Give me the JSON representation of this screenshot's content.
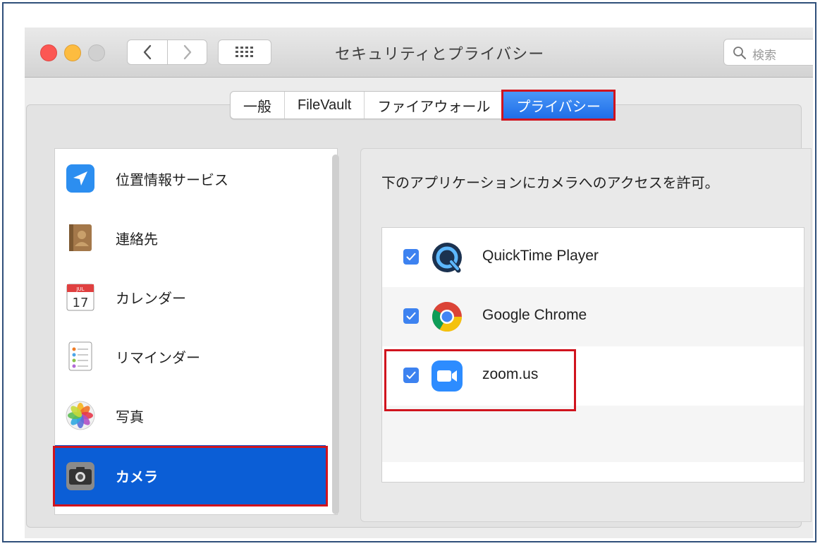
{
  "window": {
    "title": "セキュリティとプライバシー",
    "search_placeholder": "検索"
  },
  "tabs": [
    {
      "label": "一般",
      "active": false
    },
    {
      "label": "FileVault",
      "active": false
    },
    {
      "label": "ファイアウォール",
      "active": false
    },
    {
      "label": "プライバシー",
      "active": true
    }
  ],
  "sidebar": {
    "items": [
      {
        "label": "位置情報サービス",
        "icon": "location-arrow-icon"
      },
      {
        "label": "連絡先",
        "icon": "contacts-book-icon"
      },
      {
        "label": "カレンダー",
        "icon": "calendar-icon",
        "icon_text": "17",
        "icon_month": "JUL"
      },
      {
        "label": "リマインダー",
        "icon": "reminders-icon"
      },
      {
        "label": "写真",
        "icon": "photos-icon"
      },
      {
        "label": "カメラ",
        "icon": "camera-icon",
        "selected": true
      }
    ]
  },
  "main": {
    "description": "下のアプリケーションにカメラへのアクセスを許可。",
    "apps": [
      {
        "name": "QuickTime Player",
        "checked": true,
        "icon": "quicktime-icon"
      },
      {
        "name": "Google Chrome",
        "checked": true,
        "icon": "chrome-icon"
      },
      {
        "name": "zoom.us",
        "checked": true,
        "icon": "zoom-icon"
      }
    ]
  },
  "colors": {
    "accent": "#1f6ee8",
    "selection": "#0b5ed6",
    "highlight_border": "#d0141e",
    "checkbox": "#3d82f0"
  }
}
